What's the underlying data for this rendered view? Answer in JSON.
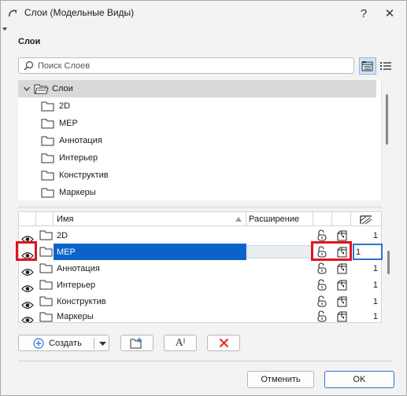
{
  "window": {
    "title": "Слои (Модельные Виды)",
    "help_label": "?",
    "close_label": "✕"
  },
  "section_title": "Слои",
  "search": {
    "placeholder": "Поиск Слоев",
    "value": ""
  },
  "tree": {
    "root_label": "Слои",
    "items": [
      "2D",
      "MEP",
      "Аннотация",
      "Интерьер",
      "Конструктив",
      "Маркеры"
    ]
  },
  "table": {
    "columns": {
      "name": "Имя",
      "extension": "Расширение"
    },
    "rows": [
      {
        "name": "2D",
        "value": "1"
      },
      {
        "name": "MEP",
        "value": "1"
      },
      {
        "name": "Аннотация",
        "value": "1"
      },
      {
        "name": "Интерьер",
        "value": "1"
      },
      {
        "name": "Конструктив",
        "value": "1"
      },
      {
        "name": "Маркеры",
        "value": "1"
      }
    ],
    "selected_index": 1
  },
  "toolbar": {
    "create_label": "Создать",
    "rename_glyph": "A",
    "rename_cursor": "I"
  },
  "footer": {
    "cancel_label": "Отменить",
    "ok_label": "OK"
  },
  "colors": {
    "selection": "#0a64c8",
    "highlight": "#e0141a",
    "delete": "#e2341d",
    "add": "#2d72d2"
  }
}
